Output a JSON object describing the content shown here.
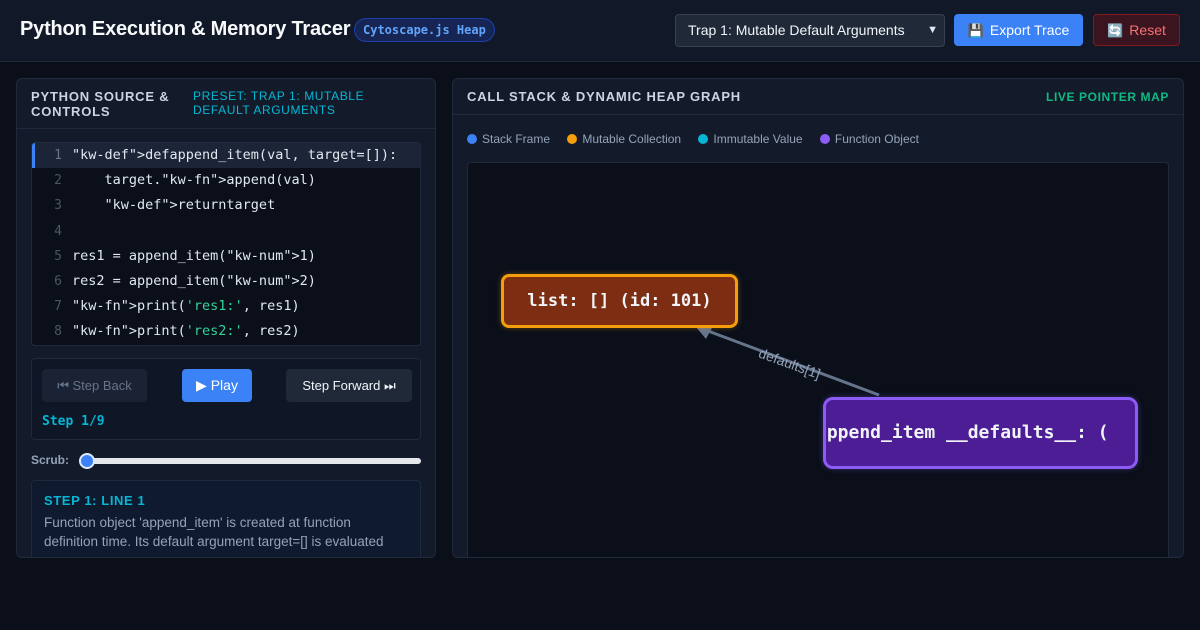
{
  "header": {
    "title": "Python Execution & Memory Tracer",
    "badge": "Cytoscape.js Heap",
    "preset_selected": "Trap 1: Mutable Default Arguments",
    "export_label": "Export Trace",
    "export_icon": "💾",
    "reset_label": "Reset",
    "reset_icon": "🔄"
  },
  "left_panel": {
    "title": "Python Source & Controls",
    "preset_label": "Preset: Trap 1: Mutable Default Arguments",
    "code": [
      {
        "num": "1",
        "text": "\"kw-def\">defappend_item(val, target=[]):"
      },
      {
        "num": "2",
        "text": "    target.\"kw-fn\">append(val)"
      },
      {
        "num": "3",
        "text": "    \"kw-def\">returntarget"
      },
      {
        "num": "4",
        "text": ""
      },
      {
        "num": "5",
        "text": "res1 = append_item(\"kw-num\">1)"
      },
      {
        "num": "6",
        "text": "res2 = append_item(\"kw-num\">2)"
      },
      {
        "num": "7",
        "pre": "\"kw-fn\">print(",
        "str": "'res1:'",
        "post": ", res1)"
      },
      {
        "num": "8",
        "pre": "\"kw-fn\">print(",
        "str": "'res2:'",
        "post": ", res2)"
      }
    ],
    "controls": {
      "back_label": "⏮ Step Back",
      "play_label": "▶ Play",
      "forward_label": "Step Forward ⏭",
      "step_text": "Step 1/9"
    },
    "scrub_label": "Scrub:",
    "scrub_value": 0,
    "explanation": {
      "title": "Step 1: Line 1",
      "body": "Function object 'append_item' is created at function definition time. Its default argument target=[] is evaluated"
    }
  },
  "right_panel": {
    "title": "Call Stack & Dynamic Heap Graph",
    "live_label": "Live Pointer Map",
    "legend": [
      {
        "label": "Stack Frame",
        "color": "#3b82f6"
      },
      {
        "label": "Mutable Collection",
        "color": "#f59e0b"
      },
      {
        "label": "Immutable Value",
        "color": "#06b6d4"
      },
      {
        "label": "Function Object",
        "color": "#8b5cf6"
      }
    ],
    "graph": {
      "list_node": "list: [] (id: 101)",
      "func_node": "append_item __defaults__: (",
      "edge_label": "defaults[1]"
    }
  },
  "colors": {
    "accent": "#3b82f6",
    "mutable": "#f59e0b",
    "function": "#8b5cf6",
    "live": "#10b981",
    "danger": "#f87171"
  }
}
